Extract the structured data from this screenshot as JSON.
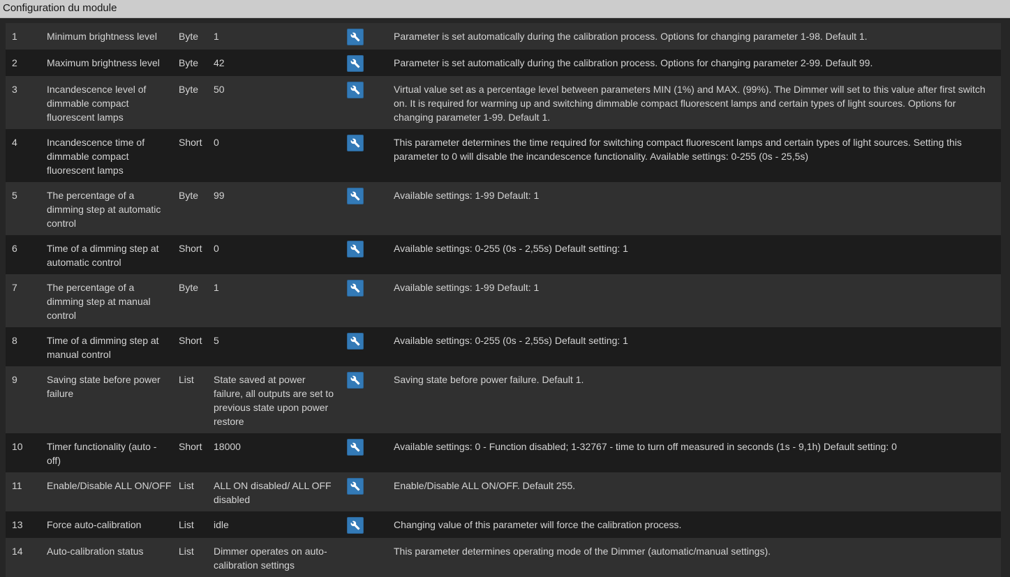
{
  "panel": {
    "title": "Configuration du module"
  },
  "colors": {
    "button_blue": "#337ab7",
    "row_odd": "#303030",
    "row_even": "#1c1c1c",
    "header_bg": "#cccccc"
  },
  "rows": [
    {
      "num": "1",
      "name": "Minimum brightness level",
      "type": "Byte",
      "value": "1",
      "has_button": true,
      "description": "Parameter is set automatically during the calibration process. Options for changing parameter 1-98. Default 1."
    },
    {
      "num": "2",
      "name": "Maximum brightness level",
      "type": "Byte",
      "value": "42",
      "has_button": true,
      "description": "Parameter is set automatically during the calibration process. Options for changing parameter 2-99. Default 99."
    },
    {
      "num": "3",
      "name": "Incandescence level of dimmable compact fluorescent lamps",
      "type": "Byte",
      "value": "50",
      "has_button": true,
      "description": "Virtual value set as a percentage level between parameters MIN (1%) and MAX. (99%). The Dimmer will set to this value after first switch on. It is required for warming up and switching dimmable compact fluorescent lamps and certain types of light sources. Options for changing parameter 1-99. Default 1."
    },
    {
      "num": "4",
      "name": "Incandescence time of dimmable compact fluorescent lamps",
      "type": "Short",
      "value": "0",
      "has_button": true,
      "description": "This parameter determines the time required for switching compact fluorescent lamps and certain types of light sources. Setting this parameter to 0 will disable the incandescence functionality. Available settings: 0-255 (0s - 25,5s)"
    },
    {
      "num": "5",
      "name": "The percentage of a dimming step at automatic control",
      "type": "Byte",
      "value": "99",
      "has_button": true,
      "description": "Available settings: 1-99 Default: 1"
    },
    {
      "num": "6",
      "name": "Time of a dimming step at automatic control",
      "type": "Short",
      "value": "0",
      "has_button": true,
      "description": "Available settings: 0-255 (0s - 2,55s) Default setting: 1"
    },
    {
      "num": "7",
      "name": "The percentage of a dimming step at manual control",
      "type": "Byte",
      "value": "1",
      "has_button": true,
      "description": "Available settings: 1-99 Default: 1"
    },
    {
      "num": "8",
      "name": "Time of a dimming step at manual control",
      "type": "Short",
      "value": "5",
      "has_button": true,
      "description": "Available settings: 0-255 (0s - 2,55s) Default setting: 1"
    },
    {
      "num": "9",
      "name": "Saving state before power failure",
      "type": "List",
      "value": "State saved at power failure, all outputs are set to previous state upon power restore",
      "has_button": true,
      "description": "Saving state before power failure. Default 1."
    },
    {
      "num": "10",
      "name": "Timer functionality (auto - off)",
      "type": "Short",
      "value": "18000",
      "has_button": true,
      "description": "Available settings: 0 - Function disabled; 1-32767 - time to turn off measured in seconds (1s - 9,1h) Default setting: 0"
    },
    {
      "num": "11",
      "name": "Enable/Disable ALL ON/OFF",
      "type": "List",
      "value": "ALL ON disabled/ ALL OFF disabled",
      "has_button": true,
      "description": "Enable/Disable ALL ON/OFF. Default 255."
    },
    {
      "num": "13",
      "name": "Force auto-calibration",
      "type": "List",
      "value": "idle",
      "has_button": true,
      "description": "Changing value of this parameter will force the calibration process."
    },
    {
      "num": "14",
      "name": "Auto-calibration status",
      "type": "List",
      "value": "Dimmer operates on auto-calibration settings",
      "has_button": false,
      "description": "This parameter determines operating mode of the Dimmer (automatic/manual settings)."
    }
  ]
}
